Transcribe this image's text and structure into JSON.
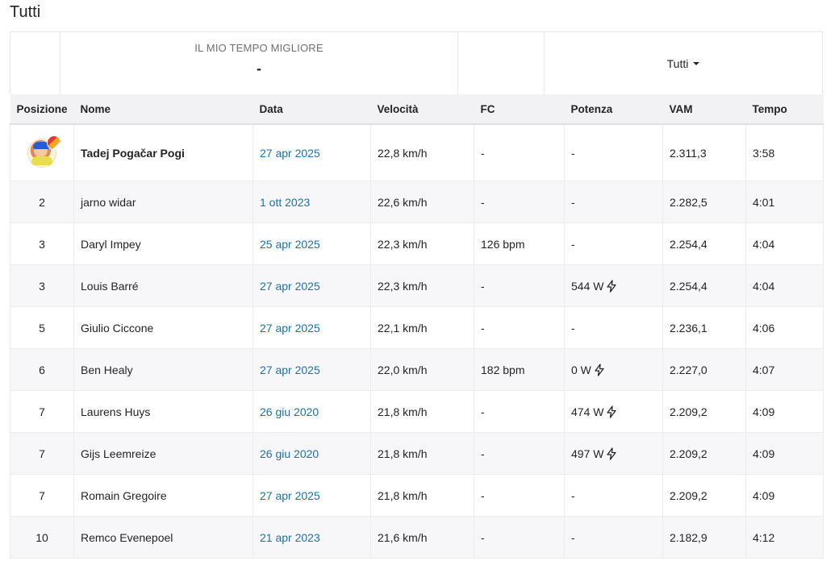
{
  "page": {
    "title": "Tutti"
  },
  "summary": {
    "best_label": "IL MIO TEMPO MIGLIORE",
    "best_value": "-",
    "filter_label": "Tutti"
  },
  "table": {
    "headers": {
      "position": "Posizione",
      "name": "Nome",
      "date": "Data",
      "speed": "Velocità",
      "hr": "FC",
      "power": "Potenza",
      "vam": "VAM",
      "time": "Tempo"
    },
    "rows": [
      {
        "rank": "",
        "name": "Tadej Pogačar Pogi",
        "date": "27 apr 2025",
        "speed": "22,8 km/h",
        "hr": "-",
        "power": "-",
        "vam": "2.311,3",
        "time": "3:58",
        "power_meter": false
      },
      {
        "rank": "2",
        "name": "jarno widar",
        "date": "1 ott 2023",
        "speed": "22,6 km/h",
        "hr": "-",
        "power": "-",
        "vam": "2.282,5",
        "time": "4:01",
        "power_meter": false
      },
      {
        "rank": "3",
        "name": "Daryl Impey",
        "date": "25 apr 2025",
        "speed": "22,3 km/h",
        "hr": "126 bpm",
        "power": "-",
        "vam": "2.254,4",
        "time": "4:04",
        "power_meter": false
      },
      {
        "rank": "3",
        "name": "Louis Barré",
        "date": "27 apr 2025",
        "speed": "22,3 km/h",
        "hr": "-",
        "power": "544 W",
        "vam": "2.254,4",
        "time": "4:04",
        "power_meter": true
      },
      {
        "rank": "5",
        "name": "Giulio Ciccone",
        "date": "27 apr 2025",
        "speed": "22,1 km/h",
        "hr": "-",
        "power": "-",
        "vam": "2.236,1",
        "time": "4:06",
        "power_meter": false
      },
      {
        "rank": "6",
        "name": "Ben Healy",
        "date": "27 apr 2025",
        "speed": "22,0 km/h",
        "hr": "182 bpm",
        "power": "0 W",
        "vam": "2.227,0",
        "time": "4:07",
        "power_meter": true
      },
      {
        "rank": "7",
        "name": "Laurens Huys",
        "date": "26 giu 2020",
        "speed": "21,8 km/h",
        "hr": "-",
        "power": "474 W",
        "vam": "2.209,2",
        "time": "4:09",
        "power_meter": true
      },
      {
        "rank": "7",
        "name": "Gijs Leemreize",
        "date": "26 giu 2020",
        "speed": "21,8 km/h",
        "hr": "-",
        "power": "497 W",
        "vam": "2.209,2",
        "time": "4:09",
        "power_meter": true
      },
      {
        "rank": "7",
        "name": "Romain Gregoire",
        "date": "27 apr 2025",
        "speed": "21,8 km/h",
        "hr": "-",
        "power": "-",
        "vam": "2.209,2",
        "time": "4:09",
        "power_meter": false
      },
      {
        "rank": "10",
        "name": "Remco Evenepoel",
        "date": "21 apr 2023",
        "speed": "21,6 km/h",
        "hr": "-",
        "power": "-",
        "vam": "2.182,9",
        "time": "4:12",
        "power_meter": false
      }
    ]
  },
  "icons": {
    "rank1": "avatar-badge-icon",
    "power_meter": "lightning-bolt-icon",
    "dropdown": "caret-down-icon"
  },
  "colors": {
    "link": "#1a73a8",
    "header_bg": "#f2f2f5",
    "stripe_bg": "#f7f7fa"
  }
}
